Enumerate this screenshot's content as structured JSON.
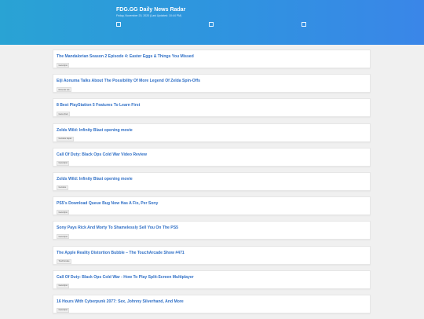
{
  "header": {
    "title": "FDG.GG Daily News Radar",
    "date": "Friday, November 20, 2020 (Last Updated: 10:44 PM)"
  },
  "articles": [
    {
      "title": "The Mandalorian Season 2 Episode 4: Easter Eggs & Things You Missed",
      "tag": "GameSpot"
    },
    {
      "title": "Eiji Aonuma Talks About The Possibility Of More Legend Of Zelda Spin-Offs",
      "tag": "Nintendo Life"
    },
    {
      "title": "8 Best PlayStation 5 Features To Learn First",
      "tag": "Game Rant"
    },
    {
      "title": "Zolds Wild: Infinity Blast opening movie",
      "tag": "Gematsu Japan"
    },
    {
      "title": "Call Of Duty: Black Ops Cold War Video Review",
      "tag": "GameSpot"
    },
    {
      "title": "Zolds Wild: Infinity Blast opening movie",
      "tag": "Gematsu"
    },
    {
      "title": "PS5's Download Queue Bug Now Has A Fix, Per Sony",
      "tag": "GameSpot"
    },
    {
      "title": "Sony Pays Rick And Morty To Shamelessly Sell You On The PS5",
      "tag": "GameSpot"
    },
    {
      "title": "The Apple Reality Distortion Bubble – The TouchArcade Show #471",
      "tag": "TouchArcade"
    },
    {
      "title": "Call Of Duty: Black Ops Cold War - How To Play Split-Screen Multiplayer",
      "tag": "GameSpot"
    },
    {
      "title": "16 Hours With Cyberpunk 2077: Sex, Johnny Silverhand, And More",
      "tag": "GameSpot"
    }
  ]
}
